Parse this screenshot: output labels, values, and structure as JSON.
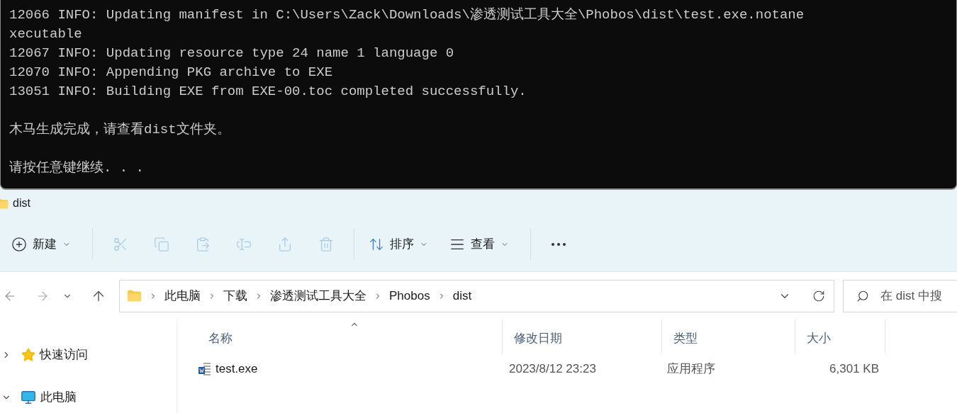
{
  "terminal": {
    "lines": [
      "12066 INFO: Updating manifest in C:\\Users\\Zack\\Downloads\\渗透测试工具大全\\Phobos\\dist\\test.exe.notane",
      "xecutable",
      "12067 INFO: Updating resource type 24 name 1 language 0",
      "12070 INFO: Appending PKG archive to EXE",
      "13051 INFO: Building EXE from EXE-00.toc completed successfully."
    ],
    "messages": [
      "木马生成完成，请查看dist文件夹。",
      "请按任意键继续. . ."
    ]
  },
  "explorer": {
    "title": "dist",
    "toolbar": [
      {
        "kind": "new",
        "label": "新建",
        "disabled": false
      },
      {
        "kind": "cut",
        "disabled": true
      },
      {
        "kind": "copy",
        "disabled": true
      },
      {
        "kind": "paste",
        "disabled": true
      },
      {
        "kind": "rename",
        "disabled": true
      },
      {
        "kind": "share",
        "disabled": true
      },
      {
        "kind": "delete",
        "disabled": true
      },
      {
        "kind": "sort",
        "label": "排序",
        "disabled": false
      },
      {
        "kind": "view",
        "label": "查看",
        "disabled": false
      },
      {
        "kind": "more",
        "disabled": false
      }
    ],
    "breadcrumb": [
      "此电脑",
      "下载",
      "渗透测试工具大全",
      "Phobos",
      "dist"
    ],
    "search": {
      "placeholder": "在 dist 中搜"
    },
    "sidebar": [
      {
        "kind": "star",
        "label": "快速访问",
        "expanded": false
      },
      {
        "kind": "pc",
        "label": "此电脑",
        "expanded": true
      }
    ],
    "columns": [
      {
        "label": "名称",
        "sorted": true
      },
      {
        "label": "修改日期",
        "sorted": false
      },
      {
        "label": "类型",
        "sorted": false
      },
      {
        "label": "大小",
        "sorted": false
      }
    ],
    "rows": [
      {
        "name": "test.exe",
        "date": "2023/8/12 23:23",
        "type": "应用程序",
        "size": "6,301 KB"
      }
    ]
  }
}
